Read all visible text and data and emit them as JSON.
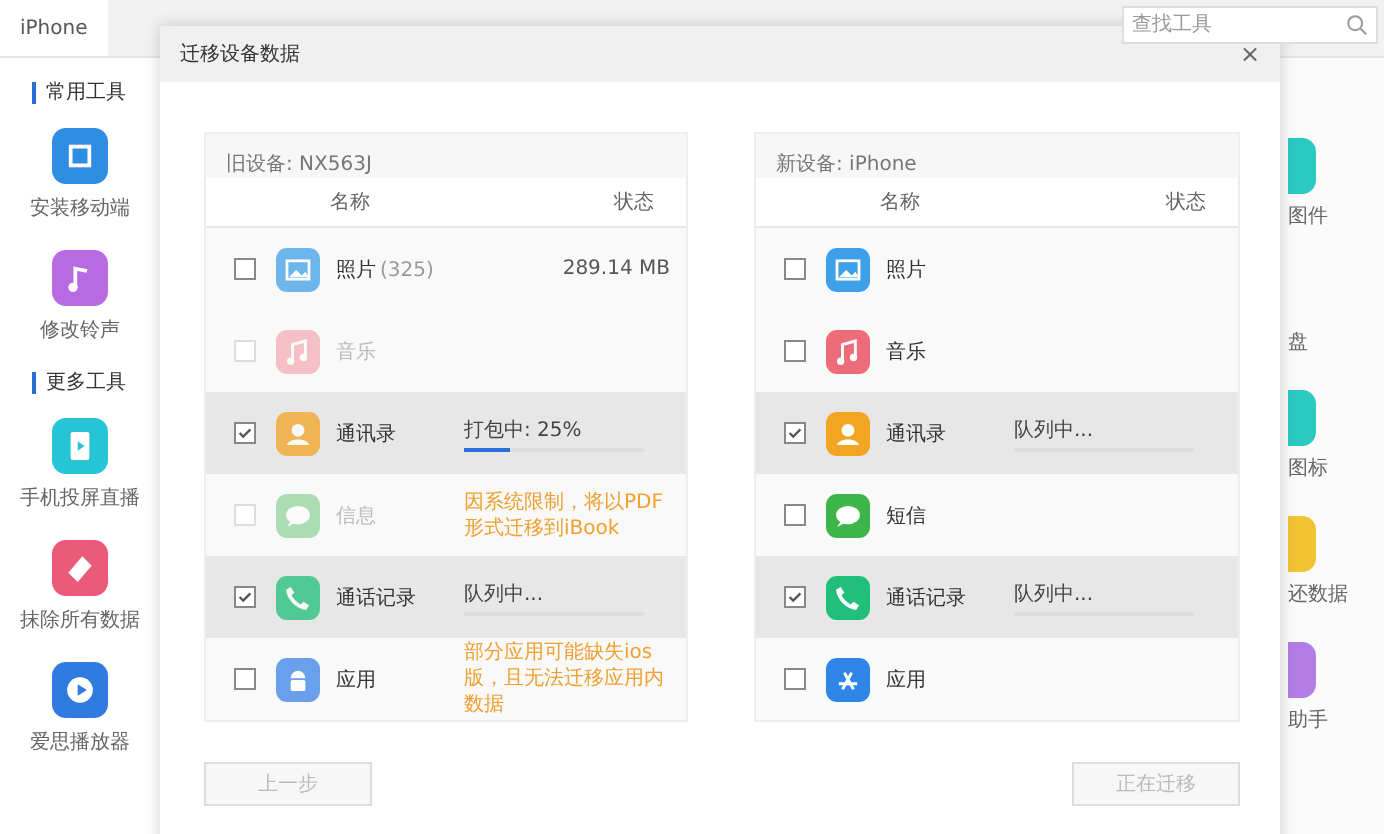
{
  "app": {
    "tab": {
      "label": "iPhone",
      "selected": true
    },
    "search": {
      "placeholder": "查找工具"
    },
    "sections": [
      {
        "title": "常用工具",
        "tools": [
          {
            "label": "安装移动端"
          },
          {
            "label": "修改铃声"
          }
        ]
      },
      {
        "title": "更多工具",
        "tools": [
          {
            "label": "手机投屏直播"
          },
          {
            "label": "抹除所有数据"
          },
          {
            "label": "爱思播放器"
          }
        ]
      }
    ],
    "right_tools": [
      {
        "label": "图件"
      },
      {
        "label": "盘"
      },
      {
        "label": "图标"
      },
      {
        "label": "还数据"
      },
      {
        "label": "助手"
      }
    ]
  },
  "dialog": {
    "title": "迁移设备数据",
    "close": "×",
    "panels": [
      {
        "device": "旧设备: NX563J",
        "columns": [
          "名称",
          "状态"
        ],
        "rows": [
          {
            "name": "照片",
            "count": "(325)",
            "checked": false,
            "disabled": false,
            "kind": "size",
            "status": "289.14 MB"
          },
          {
            "name": "音乐",
            "checked": false,
            "disabled": true,
            "kind": "plain"
          },
          {
            "name": "通讯录",
            "checked": true,
            "disabled": false,
            "kind": "progress",
            "status": "打包中: 25%",
            "level": 0.25
          },
          {
            "name": "信息",
            "checked": false,
            "disabled": true,
            "kind": "note",
            "status": "因系统限制，将以PDF形式迁移到iBook"
          },
          {
            "name": "通话记录",
            "checked": true,
            "disabled": false,
            "kind": "queued",
            "status": "队列中..."
          },
          {
            "name": "应用",
            "checked": false,
            "disabled": false,
            "kind": "note",
            "status": "部分应用可能缺失ios版，且无法迁移应用内数据"
          }
        ]
      },
      {
        "device": "新设备: iPhone",
        "columns": [
          "名称",
          "状态"
        ],
        "rows": [
          {
            "name": "照片",
            "checked": false,
            "disabled": false,
            "kind": "plain"
          },
          {
            "name": "音乐",
            "checked": false,
            "disabled": false,
            "kind": "plain"
          },
          {
            "name": "通讯录",
            "checked": true,
            "disabled": false,
            "kind": "queued",
            "status": "队列中..."
          },
          {
            "name": "短信",
            "checked": false,
            "disabled": false,
            "kind": "plain"
          },
          {
            "name": "通话记录",
            "checked": true,
            "disabled": false,
            "kind": "queued",
            "status": "队列中..."
          },
          {
            "name": "应用",
            "checked": false,
            "disabled": false,
            "kind": "plain"
          }
        ]
      }
    ],
    "buttons": [
      {
        "label": "上一步",
        "disabled": true
      },
      {
        "label": "正在迁移",
        "disabled": true
      }
    ]
  }
}
